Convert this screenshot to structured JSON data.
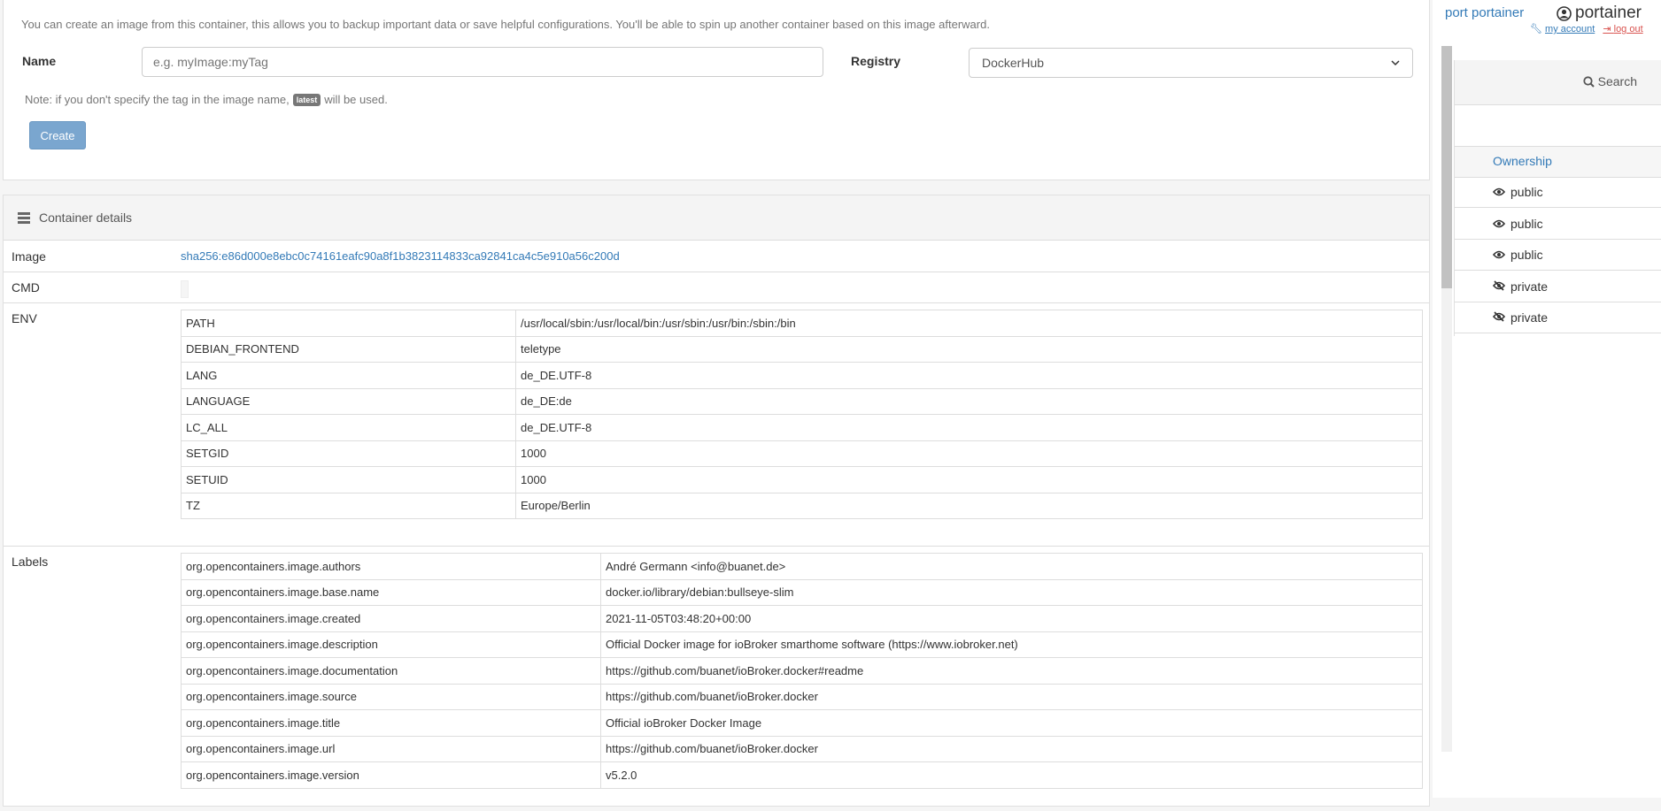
{
  "create_image": {
    "intro": "You can create an image from this container, this allows you to backup important data or save helpful configurations. You'll be able to spin up another container based on this image afterward.",
    "name_label": "Name",
    "name_placeholder": "e.g. myImage:myTag",
    "registry_label": "Registry",
    "registry_value": "DockerHub",
    "note_prefix": "Note: if you don't specify the tag in the image name,",
    "note_badge": "latest",
    "note_suffix": "will be used.",
    "create_button": "Create"
  },
  "details": {
    "title": "Container details",
    "image_label": "Image",
    "image_value": "sha256:e86d000e8ebc0c74161eafc90a8f1b3823114833ca92841ca4c5e910a56c200d",
    "cmd_label": "CMD",
    "env_label": "ENV",
    "env": [
      {
        "key": "PATH",
        "value": "/usr/local/sbin:/usr/local/bin:/usr/sbin:/usr/bin:/sbin:/bin"
      },
      {
        "key": "DEBIAN_FRONTEND",
        "value": "teletype"
      },
      {
        "key": "LANG",
        "value": "de_DE.UTF-8"
      },
      {
        "key": "LANGUAGE",
        "value": "de_DE:de"
      },
      {
        "key": "LC_ALL",
        "value": "de_DE.UTF-8"
      },
      {
        "key": "SETGID",
        "value": "1000"
      },
      {
        "key": "SETUID",
        "value": "1000"
      },
      {
        "key": "TZ",
        "value": "Europe/Berlin"
      }
    ],
    "labels_label": "Labels",
    "labels": [
      {
        "key": "org.opencontainers.image.authors",
        "value": "André Germann <info@buanet.de>"
      },
      {
        "key": "org.opencontainers.image.base.name",
        "value": "docker.io/library/debian:bullseye-slim"
      },
      {
        "key": "org.opencontainers.image.created",
        "value": "2021-11-05T03:48:20+00:00"
      },
      {
        "key": "org.opencontainers.image.description",
        "value": "Official Docker image for ioBroker smarthome software (https://www.iobroker.net)"
      },
      {
        "key": "org.opencontainers.image.documentation",
        "value": "https://github.com/buanet/ioBroker.docker#readme"
      },
      {
        "key": "org.opencontainers.image.source",
        "value": "https://github.com/buanet/ioBroker.docker"
      },
      {
        "key": "org.opencontainers.image.title",
        "value": "Official ioBroker Docker Image"
      },
      {
        "key": "org.opencontainers.image.url",
        "value": "https://github.com/buanet/ioBroker.docker"
      },
      {
        "key": "org.opencontainers.image.version",
        "value": "v5.2.0"
      }
    ]
  },
  "header": {
    "support_link": "port portainer",
    "brand": "portainer",
    "my_account": "my account",
    "log_out": "log out"
  },
  "sidebar": {
    "search_label": "Search",
    "ownership_header": "Ownership",
    "ownership": [
      "public",
      "public",
      "public",
      "private",
      "private"
    ]
  },
  "icons": {
    "eye": "eye-icon",
    "eye_slash": "eye-slash-icon",
    "search": "search-icon",
    "user": "user-circle-icon",
    "wrench": "wrench-icon",
    "signout": "sign-out-icon",
    "list": "list-icon"
  }
}
